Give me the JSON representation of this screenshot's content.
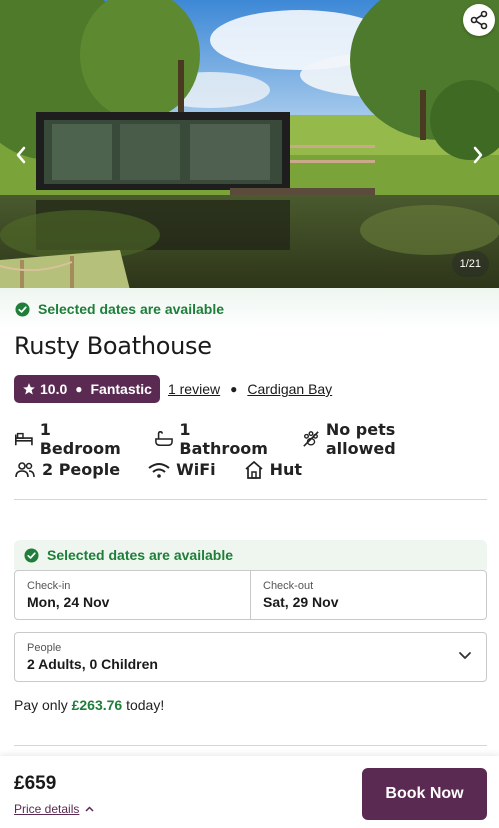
{
  "gallery": {
    "counter": "1/21",
    "share_icon": "share-icon",
    "prev_icon": "chevron-left-icon",
    "next_icon": "chevron-right-icon"
  },
  "availability": {
    "text": "Selected dates are available",
    "icon": "check-circle-icon",
    "color": "#1e7e3a"
  },
  "property": {
    "title": "Rusty Boathouse",
    "rating": {
      "score": "10.0",
      "label": "Fantastic",
      "color": "#5a2a52",
      "icon": "star-icon"
    },
    "reviews": "1 review",
    "location": "Cardigan Bay"
  },
  "features": [
    {
      "icon": "bed-icon",
      "label": "1 Bedroom"
    },
    {
      "icon": "bath-icon",
      "label": "1 Bathroom"
    },
    {
      "icon": "no-pets-icon",
      "label": "No pets allowed"
    },
    {
      "icon": "people-icon",
      "label": "2 People"
    },
    {
      "icon": "wifi-icon",
      "label": "WiFi"
    },
    {
      "icon": "home-icon",
      "label": "Hut"
    }
  ],
  "booking": {
    "availability_text": "Selected dates are available",
    "checkin": {
      "label": "Check-in",
      "value": "Mon, 24 Nov"
    },
    "checkout": {
      "label": "Check-out",
      "value": "Sat, 29 Nov"
    },
    "people": {
      "label": "People",
      "value": "2 Adults, 0 Children"
    },
    "pay_prefix": "Pay only",
    "pay_amount": "£263.76",
    "pay_suffix": "today!"
  },
  "footer": {
    "price": "£659",
    "price_details": "Price details",
    "book_button": "Book Now",
    "brand_color": "#5a2a52"
  }
}
